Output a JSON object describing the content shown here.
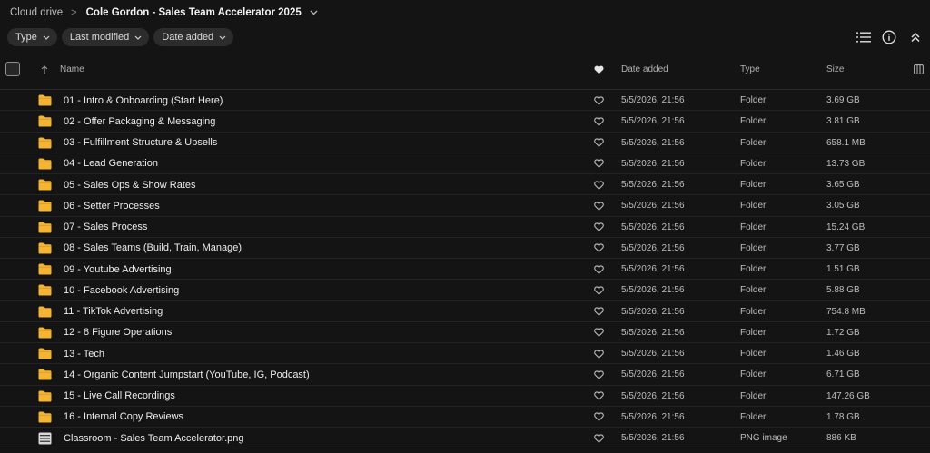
{
  "breadcrumb": {
    "root": "Cloud drive",
    "separator": ">",
    "current": "Cole Gordon - Sales Team Accelerator 2025"
  },
  "filters": [
    "Type",
    "Last modified",
    "Date added"
  ],
  "toolbar_icons": [
    "list-view-icon",
    "info-icon",
    "collapse-icon"
  ],
  "columns": {
    "name": "Name",
    "date_added": "Date added",
    "type": "Type",
    "size": "Size"
  },
  "colors": {
    "folder": "#f5b534",
    "background": "#141414"
  },
  "rows": [
    {
      "name": "01 - Intro & Onboarding (Start Here)",
      "date": "5/5/2026, 21:56",
      "type": "Folder",
      "size": "3.69 GB",
      "icon": "folder-icon"
    },
    {
      "name": "02 - Offer Packaging & Messaging",
      "date": "5/5/2026, 21:56",
      "type": "Folder",
      "size": "3.81 GB",
      "icon": "folder-icon"
    },
    {
      "name": "03 - Fulfillment Structure & Upsells",
      "date": "5/5/2026, 21:56",
      "type": "Folder",
      "size": "658.1 MB",
      "icon": "folder-icon"
    },
    {
      "name": "04 - Lead Generation",
      "date": "5/5/2026, 21:56",
      "type": "Folder",
      "size": "13.73 GB",
      "icon": "folder-icon"
    },
    {
      "name": "05 - Sales Ops & Show Rates",
      "date": "5/5/2026, 21:56",
      "type": "Folder",
      "size": "3.65 GB",
      "icon": "folder-icon"
    },
    {
      "name": "06 - Setter Processes",
      "date": "5/5/2026, 21:56",
      "type": "Folder",
      "size": "3.05 GB",
      "icon": "folder-icon"
    },
    {
      "name": "07 - Sales Process",
      "date": "5/5/2026, 21:56",
      "type": "Folder",
      "size": "15.24 GB",
      "icon": "folder-icon"
    },
    {
      "name": "08 - Sales Teams (Build, Train, Manage)",
      "date": "5/5/2026, 21:56",
      "type": "Folder",
      "size": "3.77 GB",
      "icon": "folder-icon"
    },
    {
      "name": "09 - Youtube Advertising",
      "date": "5/5/2026, 21:56",
      "type": "Folder",
      "size": "1.51 GB",
      "icon": "folder-icon"
    },
    {
      "name": "10 - Facebook Advertising",
      "date": "5/5/2026, 21:56",
      "type": "Folder",
      "size": "5.88 GB",
      "icon": "folder-icon"
    },
    {
      "name": "11 - TikTok Advertising",
      "date": "5/5/2026, 21:56",
      "type": "Folder",
      "size": "754.8 MB",
      "icon": "folder-icon"
    },
    {
      "name": "12 - 8 Figure Operations",
      "date": "5/5/2026, 21:56",
      "type": "Folder",
      "size": "1.72 GB",
      "icon": "folder-icon"
    },
    {
      "name": "13 - Tech",
      "date": "5/5/2026, 21:56",
      "type": "Folder",
      "size": "1.46 GB",
      "icon": "folder-icon"
    },
    {
      "name": "14 - Organic Content Jumpstart (YouTube, IG, Podcast)",
      "date": "5/5/2026, 21:56",
      "type": "Folder",
      "size": "6.71 GB",
      "icon": "folder-icon"
    },
    {
      "name": "15 - Live Call Recordings",
      "date": "5/5/2026, 21:56",
      "type": "Folder",
      "size": "147.26 GB",
      "icon": "folder-icon"
    },
    {
      "name": "16 - Internal Copy Reviews",
      "date": "5/5/2026, 21:56",
      "type": "Folder",
      "size": "1.78 GB",
      "icon": "folder-icon"
    },
    {
      "name": "Classroom - Sales Team Accelerator.png",
      "date": "5/5/2026, 21:56",
      "type": "PNG image",
      "size": "886 KB",
      "icon": "image-file-icon"
    }
  ]
}
